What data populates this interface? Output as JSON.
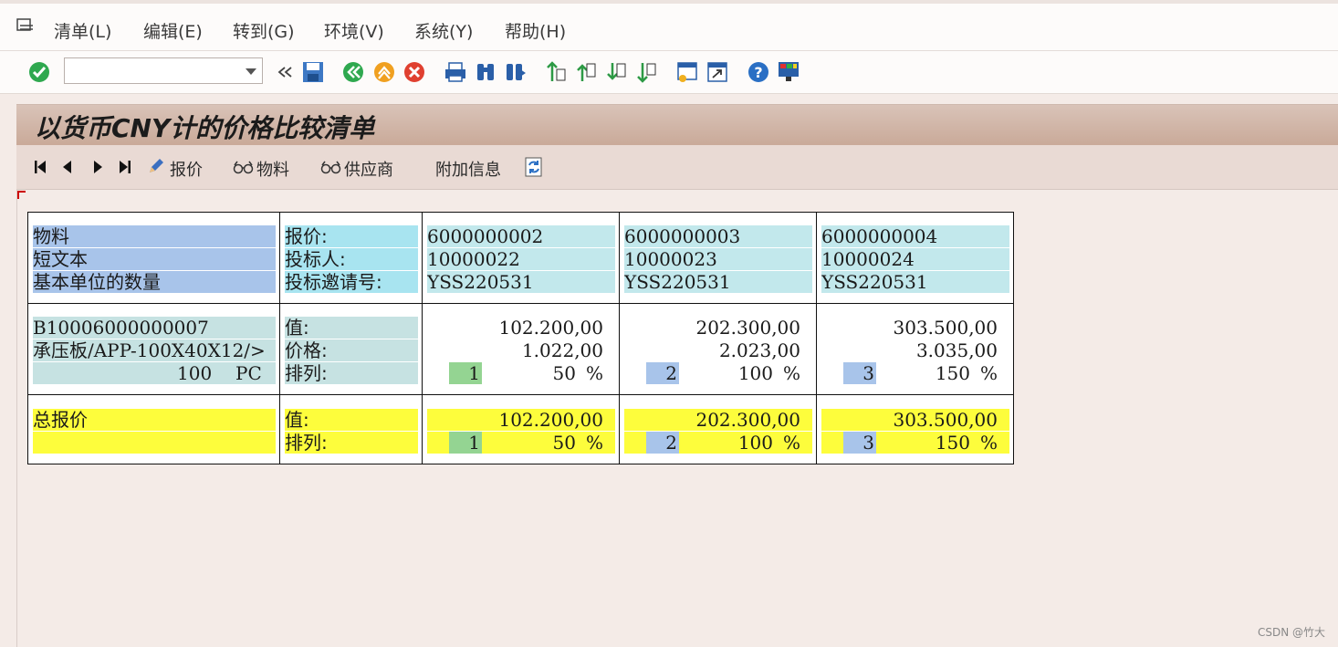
{
  "menu": {
    "items": [
      "清单(L)",
      "编辑(E)",
      "转到(G)",
      "环境(V)",
      "系统(Y)",
      "帮助(H)"
    ]
  },
  "toolbar": {
    "command_value": "",
    "icons": [
      "enter-icon",
      "command-dropdown-icon",
      "collapse-icon",
      "save-icon",
      "back-icon",
      "exit-icon",
      "cancel-icon",
      "print-icon",
      "find-icon",
      "find-next-icon",
      "first-page-icon",
      "previous-page-icon",
      "next-page-icon",
      "last-page-icon",
      "create-session-icon",
      "shortcut-icon",
      "help-icon",
      "customize-layout-icon"
    ]
  },
  "title": "以货币CNY计的价格比较清单",
  "app_toolbar": {
    "quote_label": "报价",
    "material_label": "物料",
    "vendor_label": "供应商",
    "additional_info_label": "附加信息"
  },
  "table": {
    "header": {
      "left_labels": [
        "物料",
        "短文本",
        "基本单位的数量"
      ],
      "mid_labels": [
        "报价:",
        "投标人:",
        "投标邀请号:"
      ],
      "quotes": [
        {
          "quote": "6000000002",
          "bidder": "10000022",
          "rfq": "YSS220531"
        },
        {
          "quote": "6000000003",
          "bidder": "10000023",
          "rfq": "YSS220531"
        },
        {
          "quote": "6000000004",
          "bidder": "10000024",
          "rfq": "YSS220531"
        }
      ]
    },
    "item": {
      "material": "B10006000000007",
      "short_text": "承压板/APP-100X40X12/>",
      "quantity": "100",
      "unit": "PC",
      "mid_labels": [
        "值:",
        "价格:",
        "排列:"
      ],
      "quotes": [
        {
          "value": "102.200,00",
          "price": "1.022,00",
          "rank": "1",
          "percent": "50",
          "pct_sign": "%"
        },
        {
          "value": "202.300,00",
          "price": "2.023,00",
          "rank": "2",
          "percent": "100",
          "pct_sign": "%"
        },
        {
          "value": "303.500,00",
          "price": "3.035,00",
          "rank": "3",
          "percent": "150",
          "pct_sign": "%"
        }
      ]
    },
    "total": {
      "label": "总报价",
      "mid_labels": [
        "值:",
        "排列:"
      ],
      "quotes": [
        {
          "value": "102.200,00",
          "rank": "1",
          "percent": "50",
          "pct_sign": "%"
        },
        {
          "value": "202.300,00",
          "rank": "2",
          "percent": "100",
          "pct_sign": "%"
        },
        {
          "value": "303.500,00",
          "rank": "3",
          "percent": "150",
          "pct_sign": "%"
        }
      ]
    }
  },
  "watermark": "CSDN @竹大",
  "colors": {
    "background": "#f4ebe7",
    "header_blue": "#a8c4ea",
    "header_cyan": "#a8e4f0",
    "total_yellow": "#fdfd3c",
    "rank_best_green": "#94d492",
    "rank_other_blue": "#a8c4ea"
  }
}
